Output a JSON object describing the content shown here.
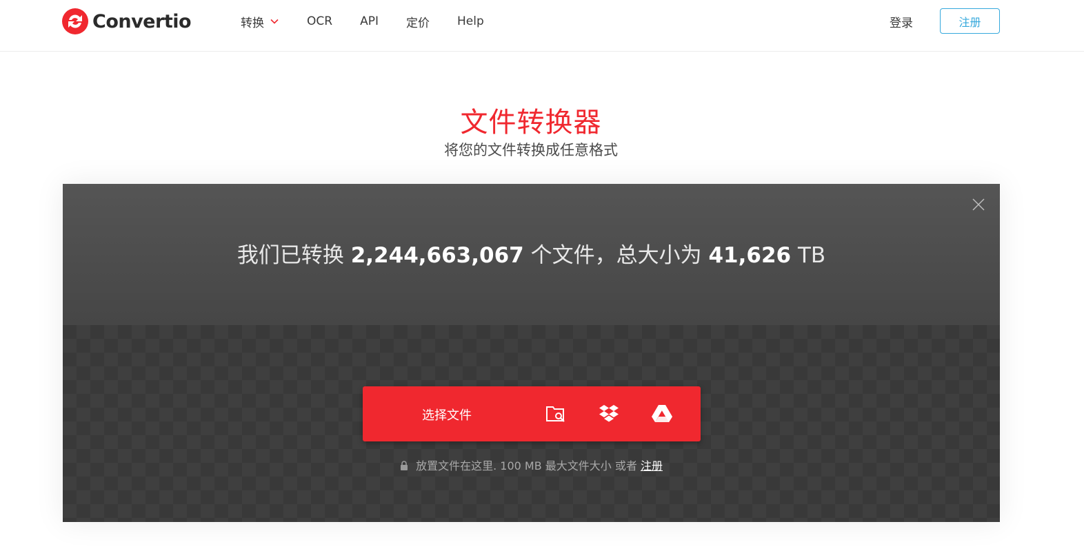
{
  "brand": {
    "name": "Convertio",
    "color": "#f0282f"
  },
  "nav": {
    "items": [
      {
        "label": "转换",
        "has_dropdown": true
      },
      {
        "label": "OCR"
      },
      {
        "label": "API"
      },
      {
        "label": "定价"
      },
      {
        "label": "Help"
      }
    ],
    "login": "登录",
    "register": "注册"
  },
  "hero": {
    "title": "文件转换器",
    "subtitle": "将您的文件转换成任意格式"
  },
  "stats": {
    "prefix": "我们已转换",
    "files_count": "2,244,663,067",
    "middle": "个文件，总大小为",
    "total_size": "41,626",
    "unit": "TB"
  },
  "upload": {
    "choose_label": "选择文件",
    "sources": [
      "folder-search-icon",
      "dropbox-icon",
      "google-drive-icon"
    ],
    "note_text": "放置文件在这里. 100 MB 最大文件大小 或者",
    "note_link": "注册"
  },
  "colors": {
    "accent_red": "#f0282f",
    "link_blue": "#35a8dc"
  }
}
